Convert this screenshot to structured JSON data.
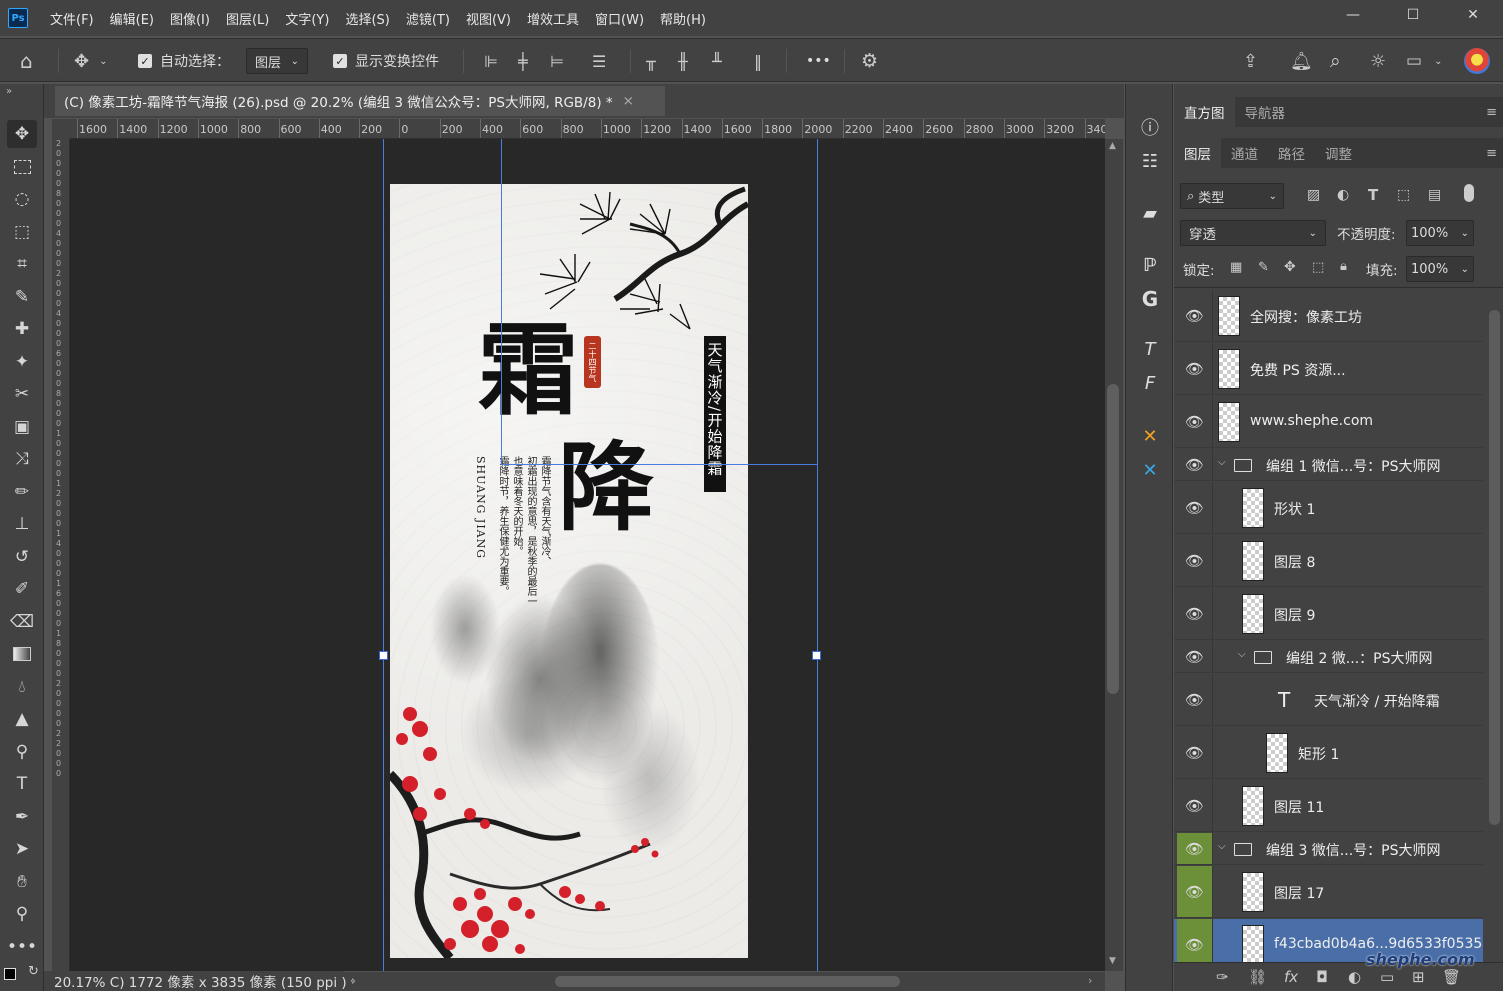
{
  "menubar": {
    "logo": "Ps",
    "items": [
      "文件(F)",
      "编辑(E)",
      "图像(I)",
      "图层(L)",
      "文字(Y)",
      "选择(S)",
      "滤镜(T)",
      "视图(V)",
      "增效工具",
      "窗口(W)",
      "帮助(H)"
    ],
    "window_controls": [
      "—",
      "☐",
      "✕"
    ]
  },
  "options": {
    "auto_select_label": "自动选择：",
    "auto_select_value": "图层",
    "show_transform_label": "显示变换控件",
    "more": "•••"
  },
  "document": {
    "tab_title": "(C) 像素工坊-霜降节气海报 (26).psd @ 20.2% (编组 3 微信公众号：PS大师网, RGB/8) *",
    "tab_close": "×"
  },
  "ruler": {
    "labels": [
      "1600",
      "1400",
      "1200",
      "1000",
      "800",
      "600",
      "400",
      "200",
      "0",
      "200",
      "400",
      "600",
      "800",
      "1000",
      "1200",
      "1400",
      "1600",
      "1800",
      "2000",
      "2200",
      "2400",
      "2600",
      "2800",
      "3000",
      "3200",
      "3400"
    ]
  },
  "status": {
    "text": "20.17%  C) 1772 像素 x 3835 像素 (150 ppi )",
    "arrow": "›"
  },
  "poster": {
    "big_char_1": "霜",
    "big_char_2": "降",
    "seal": "二十四节气",
    "vertical_title": "天气渐冷/开始降霜",
    "body_col_1": "霜降节气含有天气渐冷、",
    "body_col_2": "初霜出现的意思，是秋季的最后一",
    "body_col_3": "也意味着冬天的开始。",
    "body_col_4": "霜降时节，养生保健尤为重要。",
    "pinyin": "SHUANG JIANG"
  },
  "panels": {
    "top_tabs": [
      "直方图",
      "导航器"
    ],
    "layer_tabs": [
      "图层",
      "通道",
      "路径",
      "调整"
    ],
    "filter_label": "类型",
    "blend_mode": "穿透",
    "opacity_label": "不透明度:",
    "opacity_value": "100%",
    "lock_label": "锁定:",
    "fill_label": "填充:",
    "fill_value": "100%"
  },
  "layers": [
    {
      "name": "全网搜：像素工坊",
      "kind": "layer",
      "indent": 0
    },
    {
      "name": "免费 PS 资源...",
      "kind": "layer",
      "indent": 0
    },
    {
      "name": "www.shephe.com",
      "kind": "layer",
      "indent": 0
    },
    {
      "name": "编组 1 微信...号：PS大师网",
      "kind": "group",
      "indent": 0
    },
    {
      "name": "形状 1",
      "kind": "shape",
      "indent": 1
    },
    {
      "name": "图层 8",
      "kind": "layer",
      "indent": 1
    },
    {
      "name": "图层 9",
      "kind": "layer",
      "indent": 1
    },
    {
      "name": "编组 2 微...：PS大师网",
      "kind": "group",
      "indent": 1
    },
    {
      "name": "天气渐冷 / 开始降霜",
      "kind": "text",
      "indent": 2
    },
    {
      "name": "矩形 1",
      "kind": "shape",
      "indent": 2
    },
    {
      "name": "图层 11",
      "kind": "layer",
      "indent": 1
    },
    {
      "name": "编组 3 微信...号：PS大师网",
      "kind": "group",
      "indent": 0,
      "highlight": true
    },
    {
      "name": "图层 17",
      "kind": "layer",
      "indent": 1,
      "highlight": true
    },
    {
      "name": "f43cbad0b4a6...9d6533f0535",
      "kind": "layer",
      "indent": 1,
      "selected": true,
      "highlight": true
    }
  ],
  "watermark": "shephe.com",
  "colors": {
    "accent": "#4a6fa8",
    "guide": "#4a7be0",
    "eye_highlight": "#6c8f3a",
    "plum_red": "#d4202a"
  }
}
